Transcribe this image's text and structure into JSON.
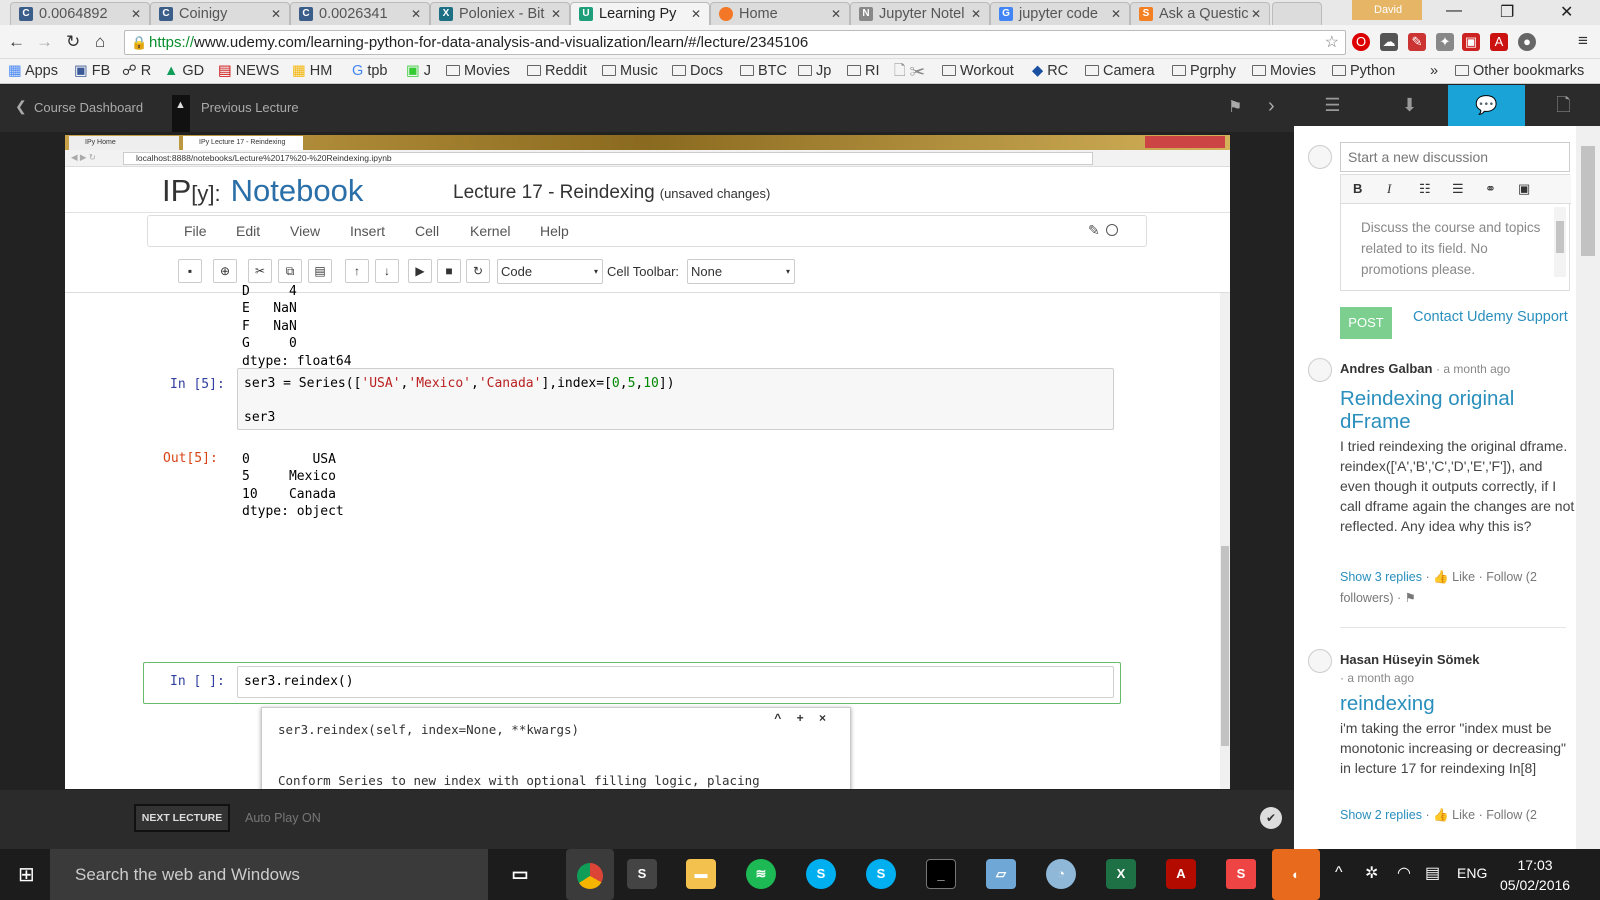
{
  "browser": {
    "tabs": [
      {
        "label": "0.0064892",
        "icon": "coinigy-icon",
        "color": "#3b5d8a"
      },
      {
        "label": "Coinigy",
        "icon": "coinigy-icon",
        "color": "#3b5d8a"
      },
      {
        "label": "0.0026341",
        "icon": "coinigy-icon",
        "color": "#3b5d8a"
      },
      {
        "label": "Poloniex - Bit",
        "icon": "poloniex-icon",
        "color": "#1d6f84"
      },
      {
        "label": "Learning Py",
        "icon": "udemy-icon",
        "color": "#1e9e7a"
      },
      {
        "label": "Home",
        "icon": "jupyter-icon",
        "color": "#f37726"
      },
      {
        "label": "Jupyter Notel",
        "icon": "notebook-icon",
        "color": "#666666"
      },
      {
        "label": "jupyter code",
        "icon": "google-icon",
        "color": "#4285f4"
      },
      {
        "label": "Ask a Questic",
        "icon": "stackoverflow-icon",
        "color": "#f48024"
      }
    ],
    "user": "David",
    "url_scheme": "https://",
    "url_rest": "www.udemy.com/learning-python-for-data-analysis-and-visualization/learn/#/lecture/2345106",
    "bookmarks": [
      "Apps",
      "FB",
      "R",
      "GD",
      "NEWS",
      "HM",
      "tpb",
      "J",
      "Movies",
      "Reddit",
      "Music",
      "Docs",
      "BTC",
      "Jp",
      "RI",
      "Workout",
      "RC",
      "Camera",
      "Pgrphy",
      "Movies",
      "Python",
      "Other bookmarks"
    ],
    "more": "»"
  },
  "player": {
    "course_dashboard": "Course Dashboard",
    "previous_lecture": "Previous Lecture",
    "next_lecture": "NEXT LECTURE",
    "auto_play": "Auto Play ON"
  },
  "inner_browser": {
    "tab1": "IPy Home",
    "tab2": "IPy Lecture 17 - Reindexing",
    "url": "localhost:8888/notebooks/Lecture%2017%20-%20Reindexing.ipynb"
  },
  "notebook": {
    "logo_ip": "IP",
    "logo_y": "[y]:",
    "logo_nb": "Notebook",
    "title": "Lecture 17 - Reindexing",
    "unsaved": "(unsaved changes)",
    "menu": [
      "File",
      "Edit",
      "View",
      "Insert",
      "Cell",
      "Kernel",
      "Help"
    ],
    "cell_type": "Code",
    "cell_toolbar_label": "Cell Toolbar:",
    "cell_toolbar_value": "None",
    "out_prev": [
      "D     4",
      "E   NaN",
      "F   NaN",
      "G     0",
      "dtype: float64"
    ],
    "in5_prompt": "In [5]:",
    "in5_line1": [
      "ser3 = Series([",
      "'USA'",
      ",",
      "'Mexico'",
      ",",
      "'Canada'",
      "],index=[",
      "0",
      ",",
      "5",
      ",",
      "10",
      "])"
    ],
    "in5_line2": "ser3",
    "out5_prompt": "Out[5]:",
    "out5": [
      "0        USA",
      "5     Mexico",
      "10    Canada",
      "dtype: object"
    ],
    "in_empty_prompt": "In [ ]:",
    "in_empty_code": "ser3.reindex()",
    "tooltip_sig": "ser3.reindex(self, index=None, **kwargs)",
    "tooltip_doc": "Conform Series to new index with optional filling logic, placing",
    "tooltip_controls": "^ + ×"
  },
  "sidebar": {
    "discussion_placeholder": "Start a new discussion",
    "editor_placeholder": "Discuss the course and topics related to its field. No promotions please.",
    "post": "POST",
    "contact": "Contact Udemy Support",
    "posts": [
      {
        "author": "Andres Galban",
        "ago": "· a month ago",
        "title": "Reindexing original dFrame",
        "body": "I tried reindexing the original dframe. reindex(['A','B','C','D','E','F']), and even though it outputs correctly, if I call dframe again the changes are not reflected. Any idea why this is?",
        "replies": "Show 3 replies",
        "like": "Like",
        "follow": "Follow (2 followers)"
      },
      {
        "author": "Hasan Hüseyin Sömek",
        "ago": "· a month ago",
        "title": "reindexing",
        "body": "i'm taking the error \"index must be monotonic increasing or decreasing\" in lecture 17 for reindexing In[8]",
        "replies": "Show 2 replies",
        "like": "Like",
        "follow": "Follow (2"
      }
    ]
  },
  "taskbar": {
    "search": "Search the web and Windows",
    "lang": "ENG",
    "time": "17:03",
    "date": "05/02/2016"
  }
}
